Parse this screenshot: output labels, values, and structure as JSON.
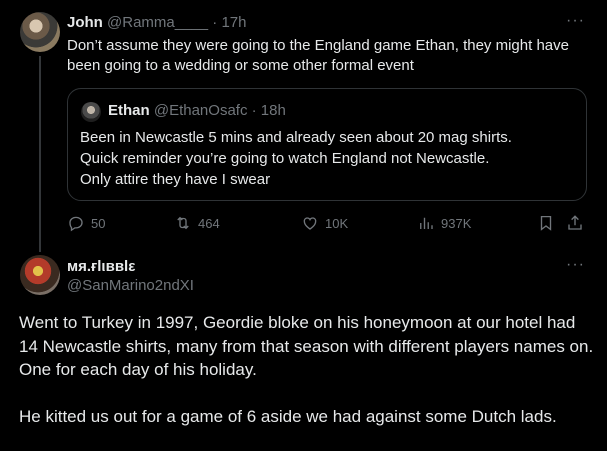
{
  "tweet1": {
    "author": "John",
    "handle": "@Ramma____",
    "separator": "·",
    "time": "17h",
    "text": "Don’t assume they were going to the England game Ethan, they might have been going to a wedding or some other formal event",
    "quote": {
      "author": "Ethan",
      "handle": "@EthanOsafc",
      "separator": "·",
      "time": "18h",
      "lines": [
        "Been in Newcastle 5 mins and already seen about 20 mag shirts.",
        "Quick reminder you’re going to watch England not Newcastle.",
        "Only attire they have I swear"
      ]
    },
    "actions": {
      "replies": "50",
      "reposts": "464",
      "likes": "10K",
      "views": "937K"
    }
  },
  "tweet2": {
    "author": "мя.ғlιввlε",
    "handle": "@SanMarino2ndXI",
    "paragraphs": [
      "Went to Turkey in 1997, Geordie bloke on his honeymoon at our hotel had 14 Newcastle shirts, many from that season with different players names on. One for each day of his holiday.",
      "He kitted us out for a game of 6 aside we had against some Dutch lads."
    ]
  },
  "icons": {
    "more": "more-dots-icon",
    "reply": "reply-bubble-icon",
    "repost": "repost-arrows-icon",
    "like": "heart-icon",
    "views": "bar-chart-icon",
    "bookmark": "bookmark-icon",
    "share": "share-upload-icon"
  },
  "colors": {
    "background": "#000000",
    "text": "#e7e9ea",
    "muted": "#71767b",
    "border": "#2f3336"
  }
}
